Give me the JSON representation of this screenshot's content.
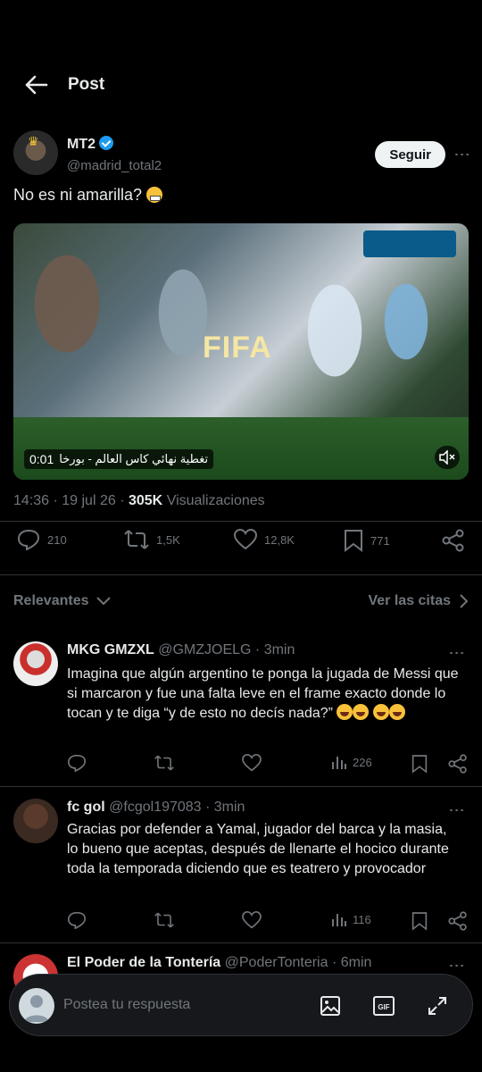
{
  "header": {
    "title": "Post"
  },
  "post": {
    "author_name": "MT2",
    "author_handle": "@madrid_total2",
    "follow_label": "Seguir",
    "text": "No es ni amarilla?",
    "media": {
      "overlay_text": "FIFA",
      "time": "0:01",
      "caption": "تغطية نهائي كاس العالم - بورخا"
    },
    "meta_time": "14:36 · 19 jul 26 ·",
    "views_count": "305K",
    "views_label": "Visualizaciones",
    "stats": {
      "replies": "210",
      "reposts": "1,5K",
      "likes": "12,8K",
      "bookmarks": "771"
    }
  },
  "filters": {
    "sort_label": "Relevantes",
    "quotes_label": "Ver las citas"
  },
  "replies": [
    {
      "name": "MKG GMZXL",
      "meta": "@GMZJOELG · 3min",
      "text": "Imagina que algún argentino te ponga la jugada de Messi que si marcaron y fue una falta leve en el frame exacto donde lo tocan y te diga “y de esto no decís nada?”",
      "views": "226"
    },
    {
      "name": "fc gol",
      "meta": "@fcgol197083 · 3min",
      "text": "Gracias por defender a Yamal, jugador del barca y la masia, lo bueno que aceptas, después de llenarte el hocico durante toda la temporada diciendo que es teatrero y provocador",
      "views": "116"
    },
    {
      "name": "El Poder de la Tontería",
      "meta": "@PoderTonteria · 6min"
    }
  ],
  "composer": {
    "placeholder": "Postea tu respuesta",
    "gif_label": "GIF"
  },
  "colors": {
    "background": "#000000",
    "text": "#e7e9ea",
    "muted": "#71767b",
    "verified": "#1d9bf0"
  }
}
